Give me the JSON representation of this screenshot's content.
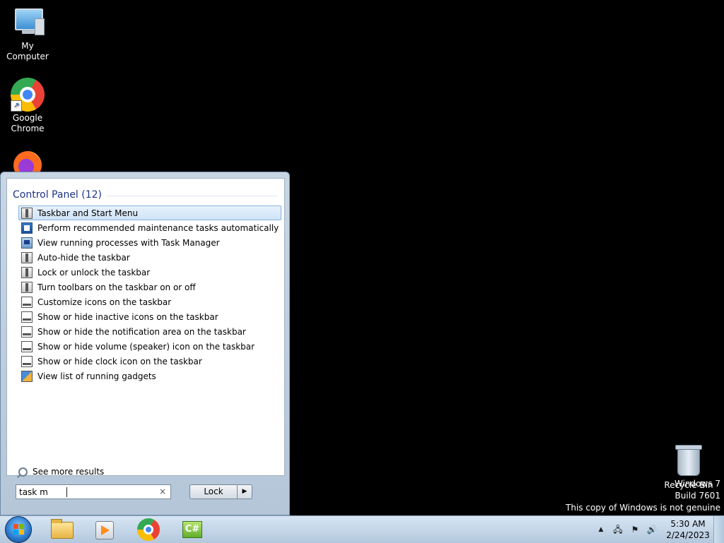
{
  "desktop": {
    "icons": [
      {
        "label": "My Computer"
      },
      {
        "label": "Google\nChrome"
      },
      {
        "label": ""
      },
      {
        "label": "Recycle Bin"
      }
    ],
    "watermark": {
      "line1": "Windows 7",
      "line2": "Build 7601",
      "line3": "This copy of Windows is not genuine"
    }
  },
  "start_menu": {
    "section_header": "Control Panel (12)",
    "results": [
      {
        "label": "Taskbar and Start Menu",
        "icon": "taskbar-icon",
        "selected": true
      },
      {
        "label": "Perform recommended maintenance tasks automatically",
        "icon": "maintenance-icon"
      },
      {
        "label": "View running processes with Task Manager",
        "icon": "task-manager-icon"
      },
      {
        "label": "Auto-hide the taskbar",
        "icon": "taskbar-icon"
      },
      {
        "label": "Lock or unlock the taskbar",
        "icon": "taskbar-icon"
      },
      {
        "label": "Turn toolbars on the taskbar on or off",
        "icon": "taskbar-icon"
      },
      {
        "label": "Customize icons on the taskbar",
        "icon": "notification-icon"
      },
      {
        "label": "Show or hide inactive icons on the taskbar",
        "icon": "notification-icon"
      },
      {
        "label": "Show or hide the notification area on the taskbar",
        "icon": "notification-icon"
      },
      {
        "label": "Show or hide volume (speaker) icon on the taskbar",
        "icon": "notification-icon"
      },
      {
        "label": "Show or hide clock icon on the taskbar",
        "icon": "notification-icon"
      },
      {
        "label": "View list of running gadgets",
        "icon": "gadgets-icon"
      }
    ],
    "see_more": "See more results",
    "search": {
      "value": "task m",
      "clear_glyph": "×"
    },
    "lock_button": "Lock",
    "lock_arrow": "▶"
  },
  "taskbar": {
    "pinned": [
      "windows-explorer-icon",
      "media-player-icon",
      "chrome-icon",
      "csharp-icon"
    ],
    "tray": {
      "overflow_glyph": "▲"
    },
    "clock": {
      "time": "5:30 AM",
      "date": "2/24/2023"
    }
  },
  "colors": {
    "desktop_bg": "#000000",
    "header_text": "#1e3287",
    "selection_bg": "#cfe4f8",
    "selection_border": "#87b2de",
    "taskbar_bg": "#c3d5e8"
  }
}
